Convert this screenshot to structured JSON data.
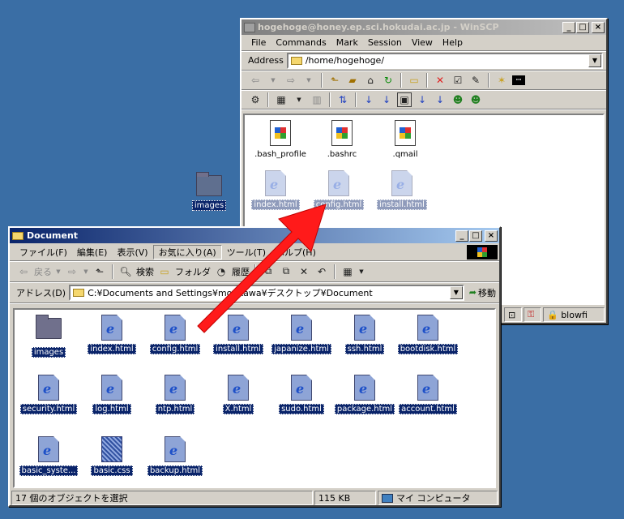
{
  "desktop": {
    "icon_label": "images"
  },
  "winscp": {
    "title": "hogehoge@honey.ep.sci.hokudai.ac.jp - WinSCP",
    "menu": [
      "File",
      "Commands",
      "Mark",
      "Session",
      "View",
      "Help"
    ],
    "address_label": "Address",
    "address_value": "/home/hogehoge/",
    "files": [
      {
        "name": ".bash_profile",
        "icon": "text-file-icon"
      },
      {
        "name": ".bashrc",
        "icon": "text-file-icon"
      },
      {
        "name": ".qmail",
        "icon": "text-file-icon"
      }
    ],
    "dragged_files": [
      "index.html",
      "config.html",
      "install.html"
    ],
    "status_text": "blowfi"
  },
  "explorer": {
    "title": "Document",
    "menu": [
      "ファイル(F)",
      "編集(E)",
      "表示(V)",
      "お気に入り(A)",
      "ツール(T)",
      "ヘルプ(H)"
    ],
    "toolbar": {
      "back": "戻る",
      "search": "検索",
      "folders": "フォルダ",
      "history": "履歴"
    },
    "address_label": "アドレス(D)",
    "address_value": "C:¥Documents and Settings¥morikawa¥デスクトップ¥Document",
    "go_label": "移動",
    "files": [
      {
        "name": "images",
        "type": "folder"
      },
      {
        "name": "index.html",
        "type": "html"
      },
      {
        "name": "config.html",
        "type": "html"
      },
      {
        "name": "install.html",
        "type": "html"
      },
      {
        "name": "japanize.html",
        "type": "html"
      },
      {
        "name": "ssh.html",
        "type": "html"
      },
      {
        "name": "bootdisk.html",
        "type": "html"
      },
      {
        "name": "security.html",
        "type": "html"
      },
      {
        "name": "log.html",
        "type": "html"
      },
      {
        "name": "ntp.html",
        "type": "html"
      },
      {
        "name": "X.html",
        "type": "html"
      },
      {
        "name": "sudo.html",
        "type": "html"
      },
      {
        "name": "package.html",
        "type": "html"
      },
      {
        "name": "account.html",
        "type": "html"
      },
      {
        "name": "basic_syste...",
        "type": "html"
      },
      {
        "name": "basic.css",
        "type": "css"
      },
      {
        "name": "backup.html",
        "type": "html"
      }
    ],
    "status": {
      "selection": "17 個のオブジェクトを選択",
      "size": "115 KB",
      "location": "マイ コンピュータ"
    }
  },
  "colors": {
    "desktop": "#3a6ea5",
    "active_title": "#0a246a",
    "arrow": "#ff1a1a"
  }
}
